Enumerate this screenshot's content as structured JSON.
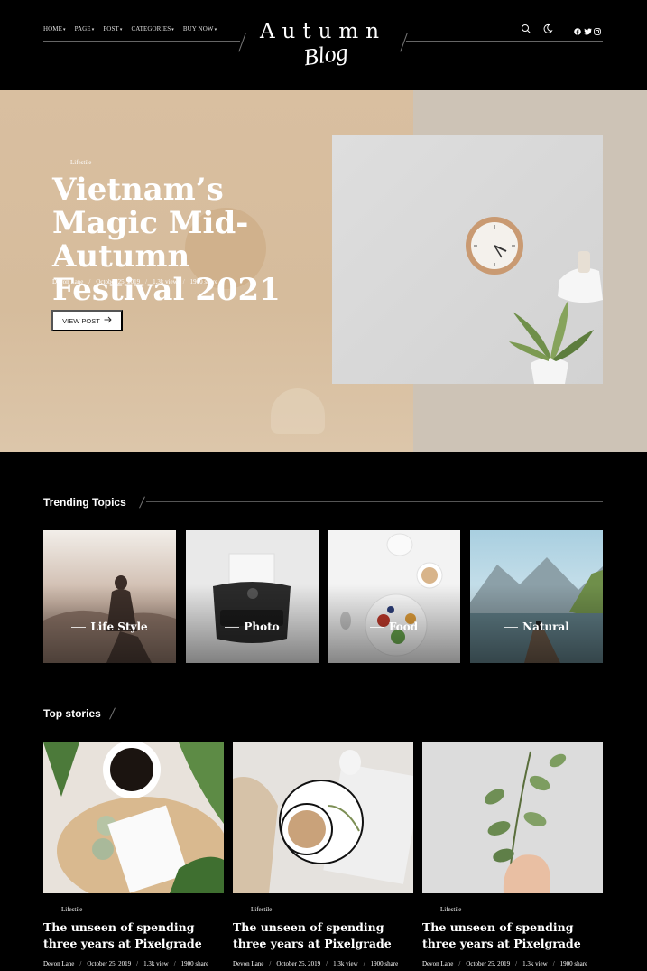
{
  "header": {
    "nav": [
      {
        "label": "HOME",
        "caret": "▾"
      },
      {
        "label": "PAGE",
        "caret": "▾"
      },
      {
        "label": "POST",
        "caret": "▾"
      },
      {
        "label": "CATEGORIES",
        "caret": "▾"
      },
      {
        "label": "BUY NOW",
        "caret": "▾"
      }
    ],
    "logo_word": "Autumn",
    "logo_script": "Blog",
    "icons": [
      "search-icon",
      "dark-mode-moon-icon",
      "facebook-icon",
      "twitter-icon",
      "instagram-icon"
    ]
  },
  "hero": {
    "category": "Lifestile",
    "title": "Vietnam’s Magic Mid-Autumn Festival 2021",
    "author": "Devon Lane",
    "date": "October 25, 2019",
    "views": "1.3k view",
    "shares": "1900 share",
    "separator": "/",
    "button_label": "VIEW POST",
    "button_icon": "arrow-right-icon"
  },
  "trending": {
    "title": "Trending Topics",
    "topics": [
      {
        "label": "Life Style"
      },
      {
        "label": "Photo"
      },
      {
        "label": "Food"
      },
      {
        "label": "Natural"
      }
    ]
  },
  "top_stories": {
    "title": "Top stories",
    "stories": [
      {
        "category": "Lifestile",
        "title": "The unseen of spending three years at Pixelgrade",
        "author": "Devon Lane",
        "date": "October 25, 2019",
        "views": "1.3k view",
        "shares": "1900 share"
      },
      {
        "category": "Lifestile",
        "title": "The unseen of spending three years at Pixelgrade",
        "author": "Devon Lane",
        "date": "October 25, 2019",
        "views": "1.3k view",
        "shares": "1900 share"
      },
      {
        "category": "Lifestile",
        "title": "The unseen of spending three years at Pixelgrade",
        "author": "Devon Lane",
        "date": "October 25, 2019",
        "views": "1.3k view",
        "shares": "1900 share"
      }
    ]
  },
  "colors": {
    "background": "#000000",
    "hero_left": "#d9bfa0",
    "hero_right": "#cdc3b6",
    "button_bg": "#ffffff"
  }
}
